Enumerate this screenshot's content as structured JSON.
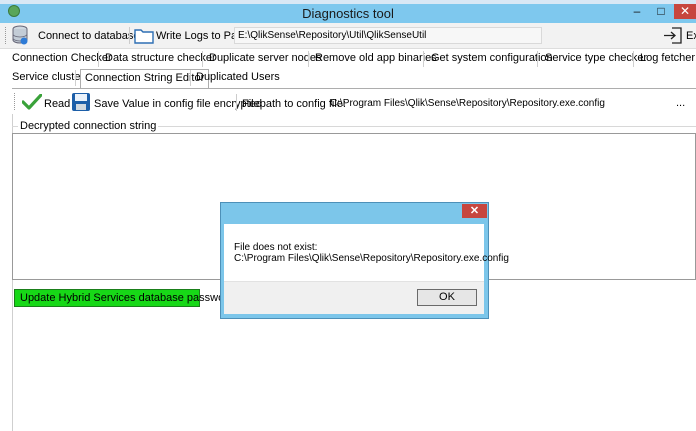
{
  "window": {
    "title": "Diagnostics tool",
    "minimize_glyph": "–",
    "maximize_glyph": "□",
    "close_glyph": "✕"
  },
  "toolbar": {
    "connect_label": "Connect to database",
    "write_logs_label": "Write Logs to Path",
    "log_path_value": "E:\\QlikSense\\Repository\\Util\\QlikSenseUtil",
    "exit_label": "Ex"
  },
  "tabs": {
    "row1": [
      "Connection Checker",
      "Data structure checker",
      "Duplicate server nodes",
      "Remove old app binaries",
      "Get system configuration",
      "Service type checker",
      "Log fetcher"
    ],
    "row2": [
      "Service cluster",
      "Connection String Editor",
      "Duplicated Users"
    ],
    "active": "Connection String Editor"
  },
  "editor": {
    "read_label": "Read",
    "save_label": "Save Value in config file encrypted",
    "filepath_label": "Filepath to config file:",
    "filepath_value": "C:\\Program Files\\Qlik\\Sense\\Repository\\Repository.exe.config",
    "browse_label": "...",
    "group_label": "Decrypted connection string",
    "update_button_label": "Update Hybrid Services database password"
  },
  "dialog": {
    "close_glyph": "✕",
    "message_line1": "File does not exist:",
    "message_line2": "C:\\Program Files\\Qlik\\Sense\\Repository\\Repository.exe.config",
    "ok_label": "OK"
  },
  "colors": {
    "titlebar": "#7ec8ee",
    "close_red": "#c7463e",
    "update_green": "#17d817",
    "dialog_frame": "#7cc6ea"
  }
}
